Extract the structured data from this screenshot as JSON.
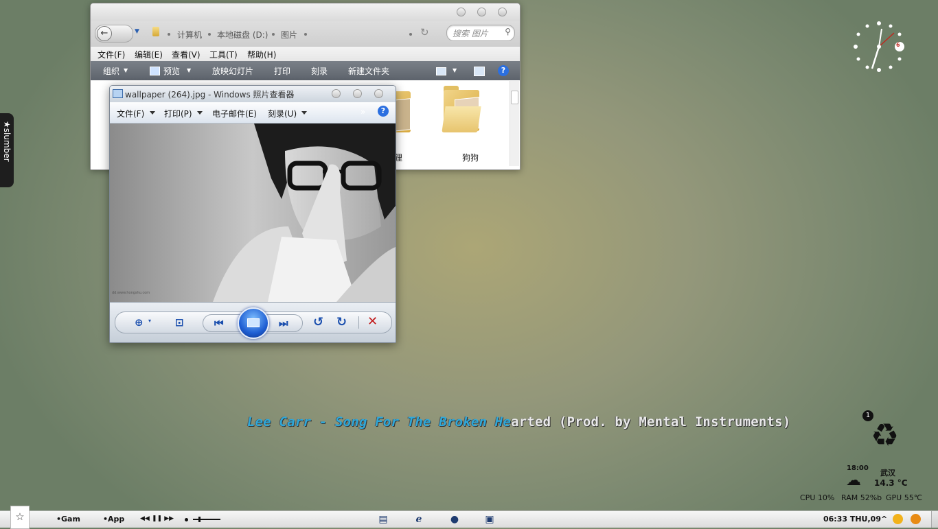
{
  "explorer": {
    "breadcrumb": [
      "计算机",
      "本地磁盘 (D:)",
      "图片"
    ],
    "search_placeholder": "搜索 图片",
    "menu": [
      "文件(F)",
      "编辑(E)",
      "查看(V)",
      "工具(T)",
      "帮助(H)"
    ],
    "toolbar": [
      "组织",
      "预览",
      "放映幻灯片",
      "打印",
      "刻录",
      "新建文件夹"
    ],
    "folders": [
      "狸",
      "狗狗"
    ]
  },
  "viewer": {
    "title": "wallpaper (264).jpg - Windows 照片查看器",
    "menu": [
      "文件(F)",
      "打印(P)",
      "电子邮件(E)",
      "刻录(U)"
    ],
    "watermark": "dd.www.hongshu.com"
  },
  "desktop": {
    "slumber": "★slumber",
    "song_highlight": "Lee Carr - Song For The Broken He",
    "song_rest": "arted (Prod. by Mental Instruments)",
    "recycle_badge": "1",
    "clock_date": "6",
    "weather": {
      "time": "18:00",
      "city": "武汉",
      "temp": "14.3 °C"
    },
    "system": {
      "cpu": "CPU 10%",
      "ram": "RAM 52%b",
      "gpu": "GPU 55℃"
    }
  },
  "taskbar": {
    "star": "☆",
    "game": "•Gam",
    "app": "•App",
    "media": "◀◀ ❚❚ ▶▶",
    "clock": "06:33 THU,09",
    "tray_caret": "^"
  },
  "colors": {
    "song_highlight": "#2fa8d9",
    "toolbar_bg": "#5d636c",
    "accent_blue": "#1b4fae"
  }
}
